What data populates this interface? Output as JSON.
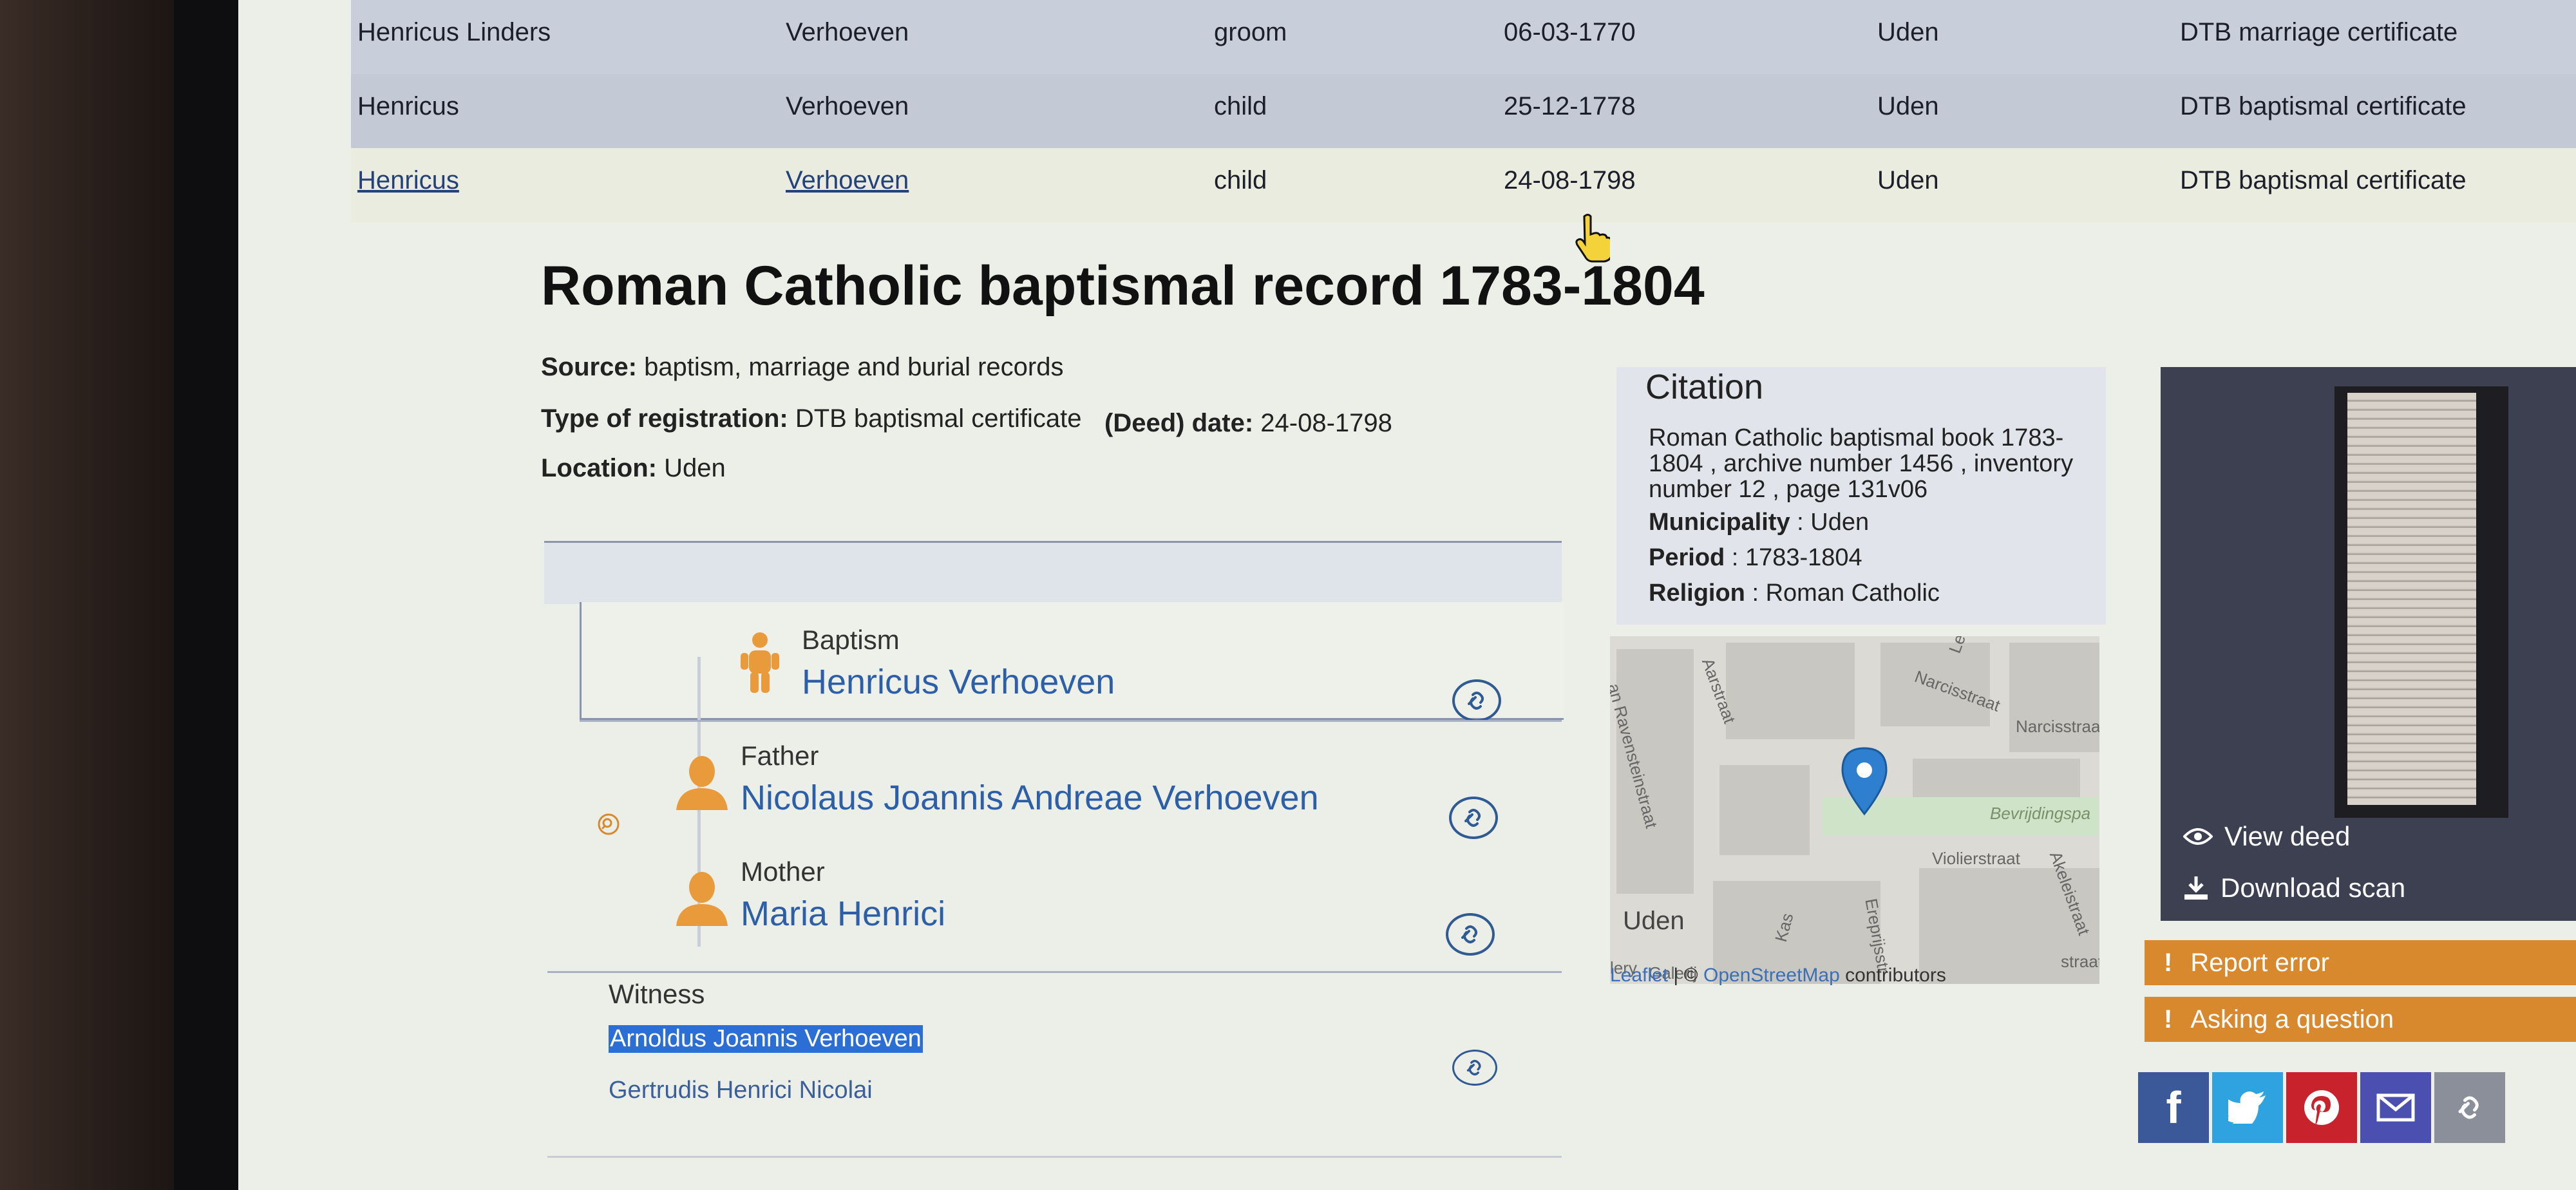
{
  "results": [
    {
      "first_name": "Henricus  Linders",
      "last_name": "Verhoeven",
      "role": "groom",
      "date": "06-03-1770",
      "place": "Uden",
      "source": "DTB marriage certificate"
    },
    {
      "first_name": "Henricus",
      "last_name": "Verhoeven",
      "role": "child",
      "date": "25-12-1778",
      "place": "Uden",
      "source": "DTB baptismal certificate"
    },
    {
      "first_name": "Henricus",
      "last_name": "Verhoeven",
      "role": "child",
      "date": "24-08-1798",
      "place": "Uden",
      "source": "DTB baptismal certificate"
    }
  ],
  "record": {
    "title": "Roman Catholic baptismal record 1783-1804",
    "source_label": "Source:",
    "source_value": "baptism, marriage and burial records",
    "type_label": "Type of registration:",
    "type_value": "DTB baptismal certificate",
    "date_label": "(Deed) date:",
    "date_value": "24-08-1798",
    "location_label": "Location:",
    "location_value": "Uden"
  },
  "persons": {
    "baptism": {
      "role": "Baptism",
      "name": "Henricus Verhoeven"
    },
    "father": {
      "role": "Father",
      "name": "Nicolaus Joannis Andreae Verhoeven"
    },
    "mother": {
      "role": "Mother",
      "name": "Maria Henrici"
    },
    "witness_label": "Witness",
    "witnesses": [
      "Arnoldus Joannis Verhoeven",
      "Gertrudis Henrici Nicolai"
    ]
  },
  "citation": {
    "title": "Citation",
    "text": "Roman Catholic baptismal book 1783-1804 , archive number 1456 , inventory number 12 , page 131v06",
    "municipality_label": "Municipality",
    "municipality": "Uden",
    "period_label": "Period",
    "period": "1783-1804",
    "religion_label": "Religion",
    "religion": "Roman Catholic"
  },
  "map": {
    "city": "Uden",
    "streets": [
      "an Ravensteinstraat",
      "Aarstraat",
      "Leeuwer",
      "Narcisstraat",
      "Narcisstraat",
      "Bevrijdingspa",
      "Violierstraat",
      "Ereprijsstr",
      "Akeleistraat",
      "Kas",
      "lery",
      "Galerij",
      "straat"
    ],
    "attribution_leaflet": "Leaflet",
    "attribution_sep": " | © ",
    "attribution_osm": "OpenStreetMap",
    "attribution_rest": " contributors"
  },
  "deed": {
    "view_label": "View deed",
    "download_label": "Download scan",
    "report_label": "Report error",
    "ask_label": "Asking a question",
    "exclaim": "!"
  },
  "share": {
    "facebook": "f"
  },
  "colors": {
    "accent_orange": "#d8892e",
    "link_blue": "#2c5fa8",
    "facebook": "#3b5998",
    "twitter": "#2fa3e0",
    "pinterest": "#c8232c",
    "email": "#4a4fb0",
    "link": "#8a8f99"
  }
}
